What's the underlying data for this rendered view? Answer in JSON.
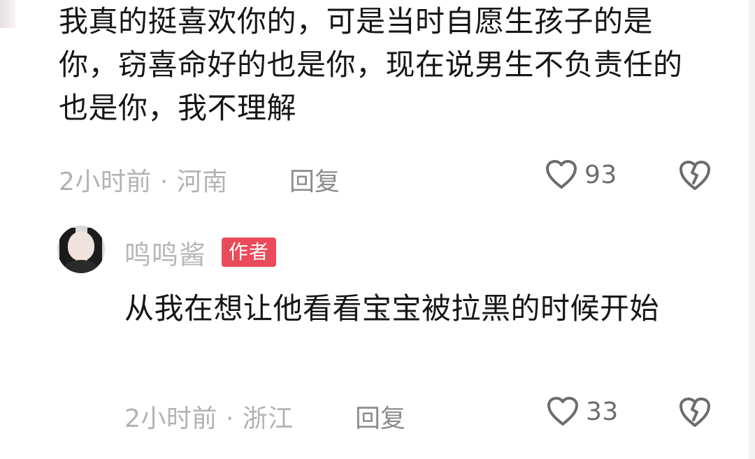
{
  "comment": {
    "text": "我真的挺喜欢你的，可是当时自愿生孩子的是你，窃喜命好的也是你，现在说男生不负责任的也是你，我不理解",
    "time_location": "2小时前 · 河南",
    "reply_label": "回复",
    "like_count": "93",
    "like_icon": "heart-icon",
    "dislike_icon": "broken-heart-icon"
  },
  "reply": {
    "username": "鸣鸣酱",
    "badge": "作者",
    "text": "从我在想让他看看宝宝被拉黑的时候开始",
    "time_location": "2小时前 · 浙江",
    "reply_label": "回复",
    "like_count": "33",
    "like_icon": "heart-icon",
    "dislike_icon": "broken-heart-icon"
  },
  "colors": {
    "primary_text": "#161616",
    "meta_text": "#b3b3b3",
    "icon_stroke": "#6c6c6c",
    "badge_bg": "#ea4a5a"
  }
}
